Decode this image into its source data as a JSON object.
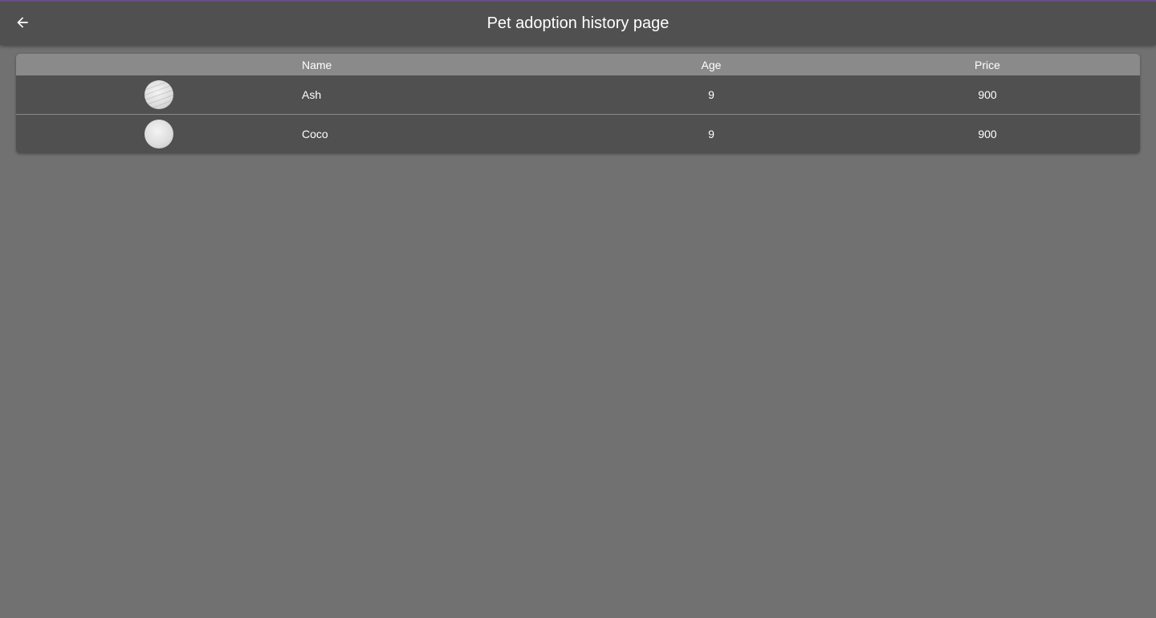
{
  "appbar": {
    "title": "Pet adoption history page",
    "back_icon": "arrow-left-icon"
  },
  "table": {
    "columns": [
      "Name",
      "Age",
      "Price"
    ],
    "rows": [
      {
        "name": "Ash",
        "age": "9",
        "price": "900"
      },
      {
        "name": "Coco",
        "age": "9",
        "price": "900"
      }
    ]
  },
  "colors": {
    "background": "#717171",
    "appbar": "#505050",
    "table_header": "#8a8a8a",
    "accent_line": "#6b4f8f"
  }
}
